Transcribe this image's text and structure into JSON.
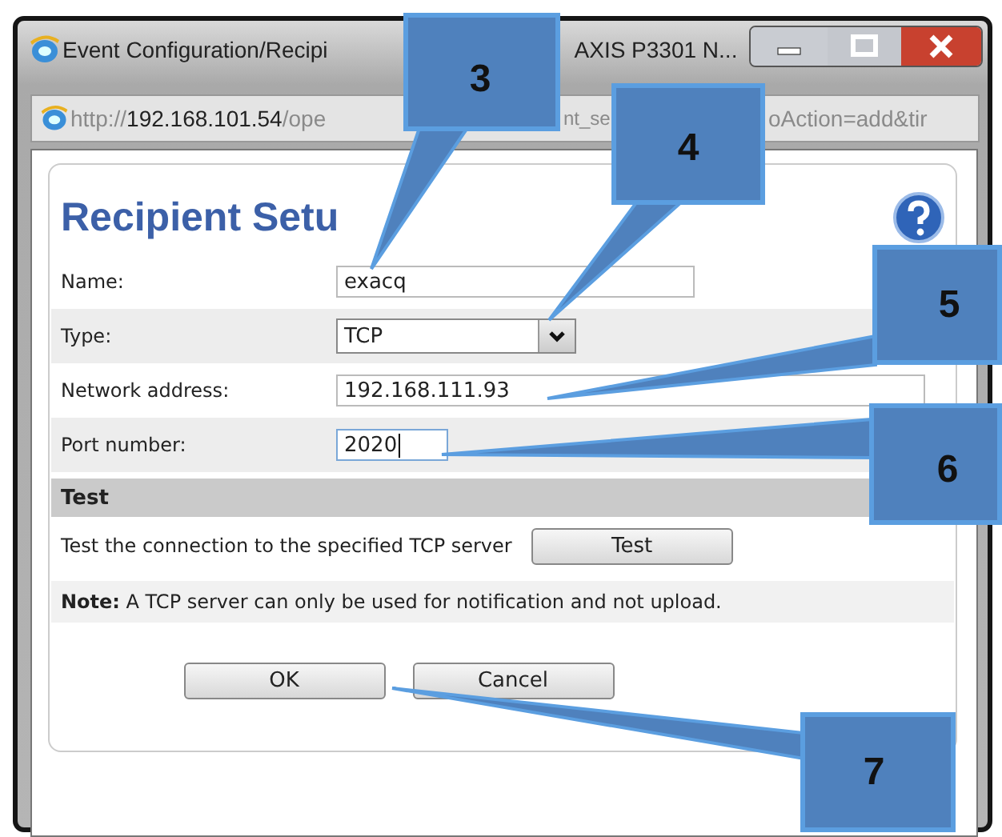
{
  "window": {
    "title_visible": [
      "Event Configuration/Recipi",
      "AXIS P3301 N..."
    ]
  },
  "address_bar": {
    "scheme": "http://",
    "host": "192.168.101.54",
    "path_visible": [
      "/ope",
      "nt_se",
      "oAction=add&tir"
    ]
  },
  "heading": "Recipient Setu",
  "fields": [
    {
      "kind": "text",
      "label": "Name:",
      "value": "exacq",
      "focused": false
    },
    {
      "kind": "select",
      "label": "Type:",
      "value": "TCP",
      "focused": false
    },
    {
      "kind": "text",
      "label": "Network address:",
      "value": "192.168.111.93",
      "focused": false
    },
    {
      "kind": "text",
      "label": "Port number:",
      "value": "2020",
      "focused": true
    }
  ],
  "test_section": {
    "title": "Test",
    "description": "Test the connection to the specified TCP server",
    "button": "Test"
  },
  "note": "**Note:** A TCP server can only be used for notification and not upload.",
  "buttons": [
    "OK",
    "Cancel"
  ],
  "callouts": [
    {
      "label": "3"
    },
    {
      "label": "4"
    },
    {
      "label": "5"
    },
    {
      "label": "6"
    },
    {
      "label": "7"
    }
  ]
}
